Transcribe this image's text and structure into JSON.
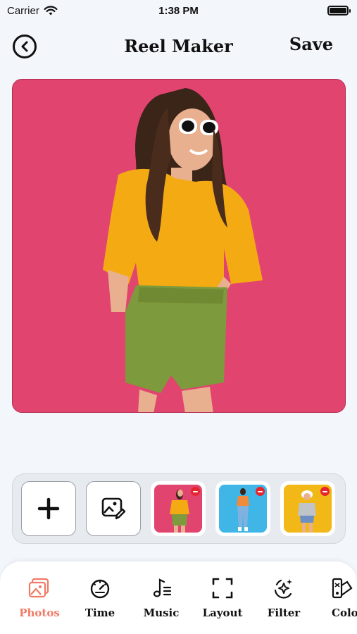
{
  "status_bar": {
    "carrier": "Carrier",
    "time": "1:38 PM"
  },
  "header": {
    "title": "Reel Maker",
    "save_label": "Save"
  },
  "colors": {
    "accent": "#f07a66",
    "preview_bg": "#e1446f",
    "thumb_blue": "#3fb6e6",
    "thumb_yellow": "#f2b817"
  },
  "thumbnails": [
    {
      "name": "woman-yellow-shirt-pink-background"
    },
    {
      "name": "woman-orange-top-blue-background"
    },
    {
      "name": "woman-grey-top-yellow-background"
    }
  ],
  "toolbar": {
    "items": [
      {
        "label": "Photos",
        "icon": "photos-icon",
        "active": true
      },
      {
        "label": "Time",
        "icon": "timer-icon",
        "active": false
      },
      {
        "label": "Music",
        "icon": "music-icon",
        "active": false
      },
      {
        "label": "Layout",
        "icon": "layout-icon",
        "active": false
      },
      {
        "label": "Filter",
        "icon": "filter-icon",
        "active": false
      },
      {
        "label": "Colo",
        "icon": "color-icon",
        "active": false
      }
    ]
  }
}
